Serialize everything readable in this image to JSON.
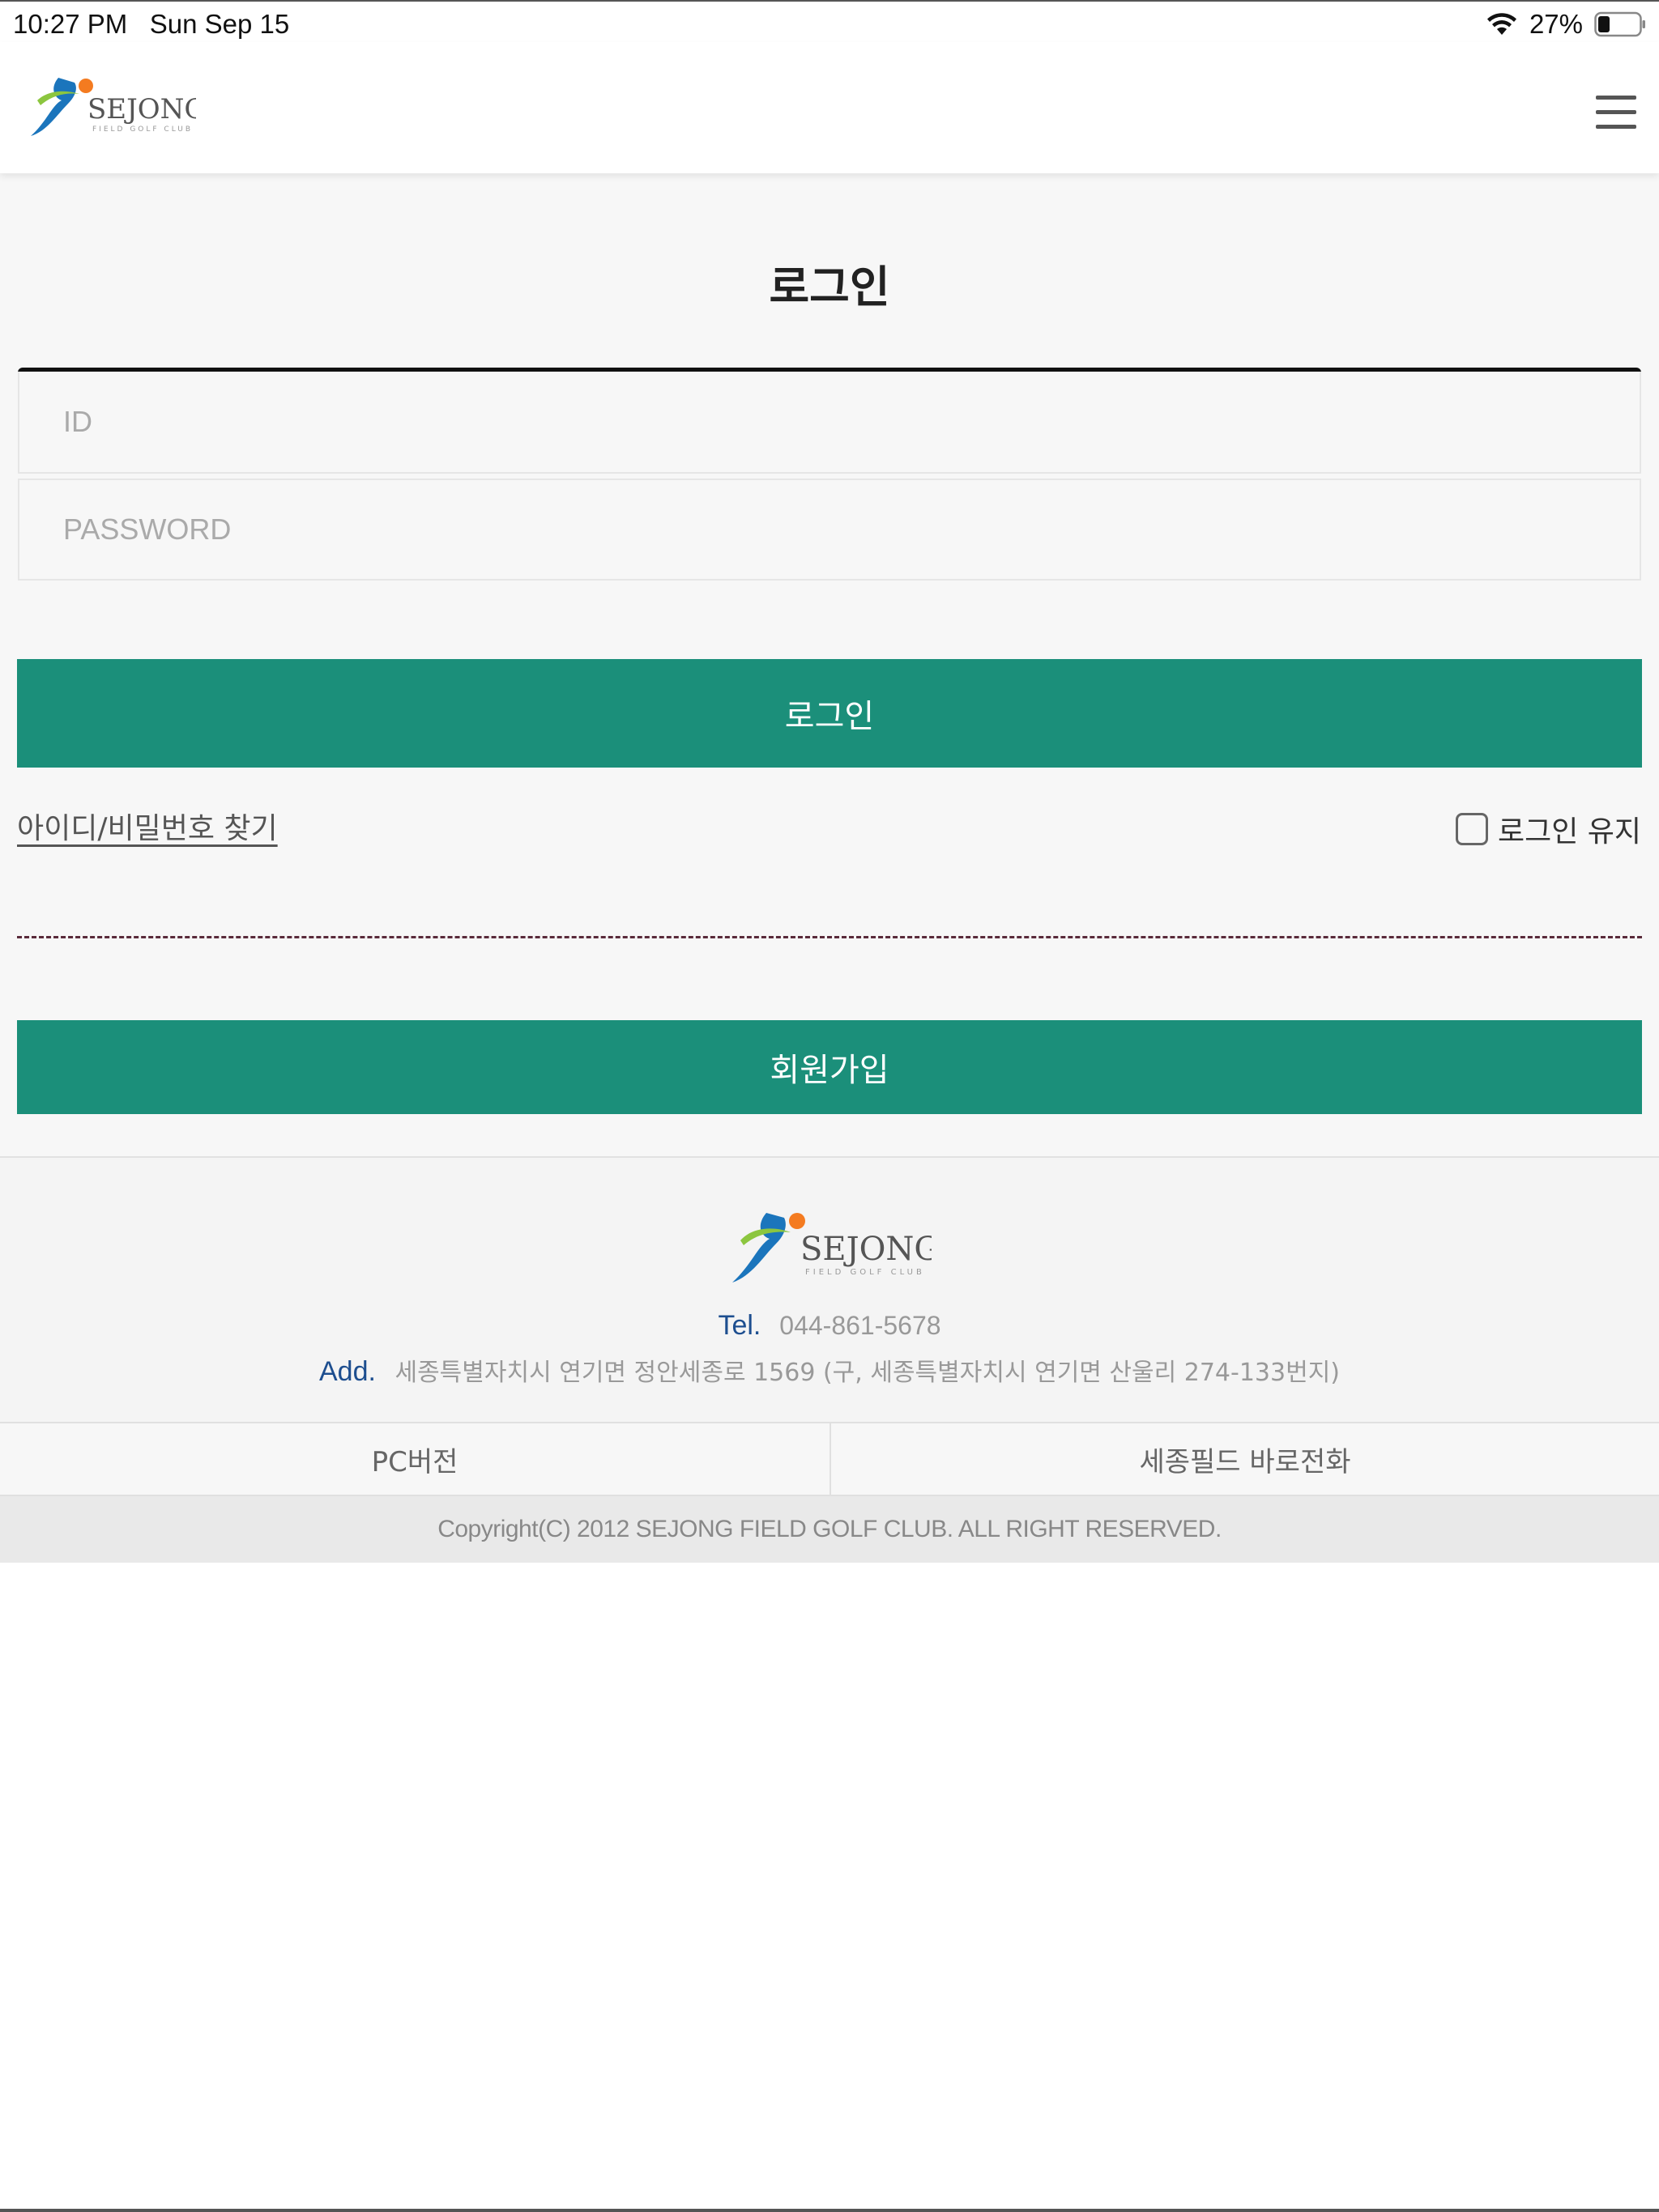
{
  "status_bar": {
    "time": "10:27 PM",
    "date": "Sun Sep 15",
    "battery": "27%"
  },
  "header": {
    "logo_text": "SEJONG",
    "logo_subtext": "FIELD GOLF CLUB",
    "menu_icon": "hamburger-menu-icon"
  },
  "login": {
    "title": "로그인",
    "id_placeholder": "ID",
    "password_placeholder": "PASSWORD",
    "login_button": "로그인",
    "find_link": "아이디/비밀번호 찾기",
    "keep_login_label": "로그인 유지",
    "signup_button": "회원가입"
  },
  "footer": {
    "logo_text": "SEJONG",
    "logo_subtext": "FIELD GOLF CLUB",
    "tel_label": "Tel.",
    "tel_value": "044-861-5678",
    "add_label": "Add.",
    "add_value": "세종특별자치시 연기면 정안세종로 1569 (구, 세종특별자치시 연기면 산울리 274-133번지)",
    "links": [
      "PC버전",
      "세종필드 바로전화"
    ],
    "copyright": "Copyright(C) 2012 SEJONG FIELD GOLF CLUB. ALL RIGHT RESERVED."
  },
  "colors": {
    "accent_green": "#1b8f7a",
    "label_blue": "#1d4e8f",
    "logo_green": "#8cc63f",
    "logo_orange": "#f47b20",
    "logo_blue": "#1b75bc"
  }
}
